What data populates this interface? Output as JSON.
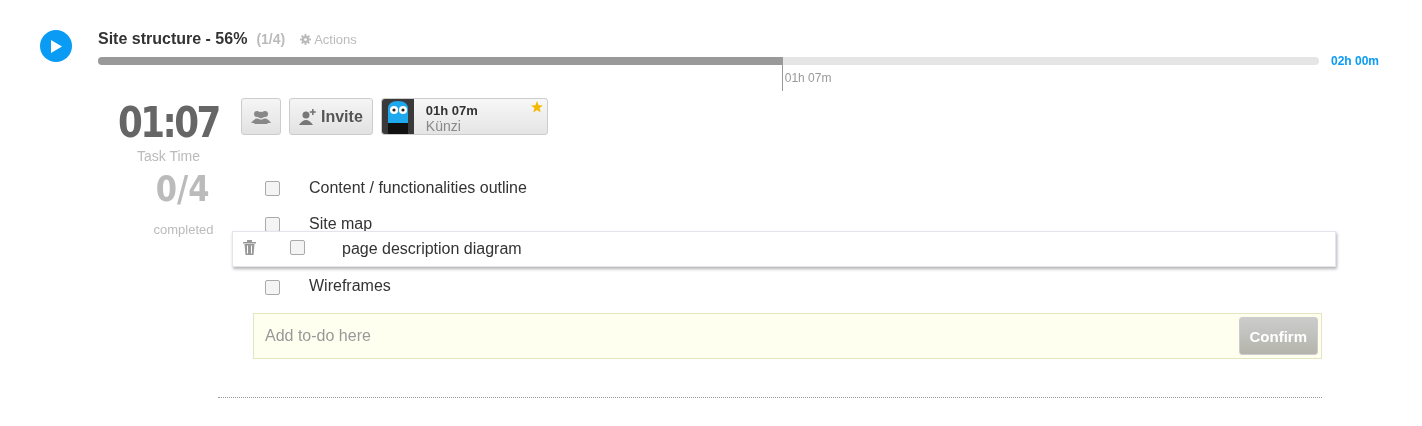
{
  "task": {
    "title": "Site structure - 56%",
    "count": "(1/4)",
    "actions": "Actions",
    "level": 0.56,
    "marker": "01h 07m",
    "estimate": "02h 00m",
    "playing": false
  },
  "stats": {
    "time": "01:07",
    "time_label": "Task Time",
    "done": "0/4",
    "done_label": "completed"
  },
  "toolbar": {
    "invite": "Invite",
    "member": {
      "time": "01h 07m",
      "name": "Künzi",
      "starred": true
    }
  },
  "todos": [
    {
      "text": "Content / functionalities outline",
      "checked": false
    },
    {
      "text": "Site map",
      "checked": false
    },
    {
      "text": "Wireframes",
      "checked": false
    }
  ],
  "dragged": {
    "text": "page description diagram",
    "checked": false
  },
  "add": {
    "placeholder": "Add to-do here",
    "button": "Confirm"
  }
}
